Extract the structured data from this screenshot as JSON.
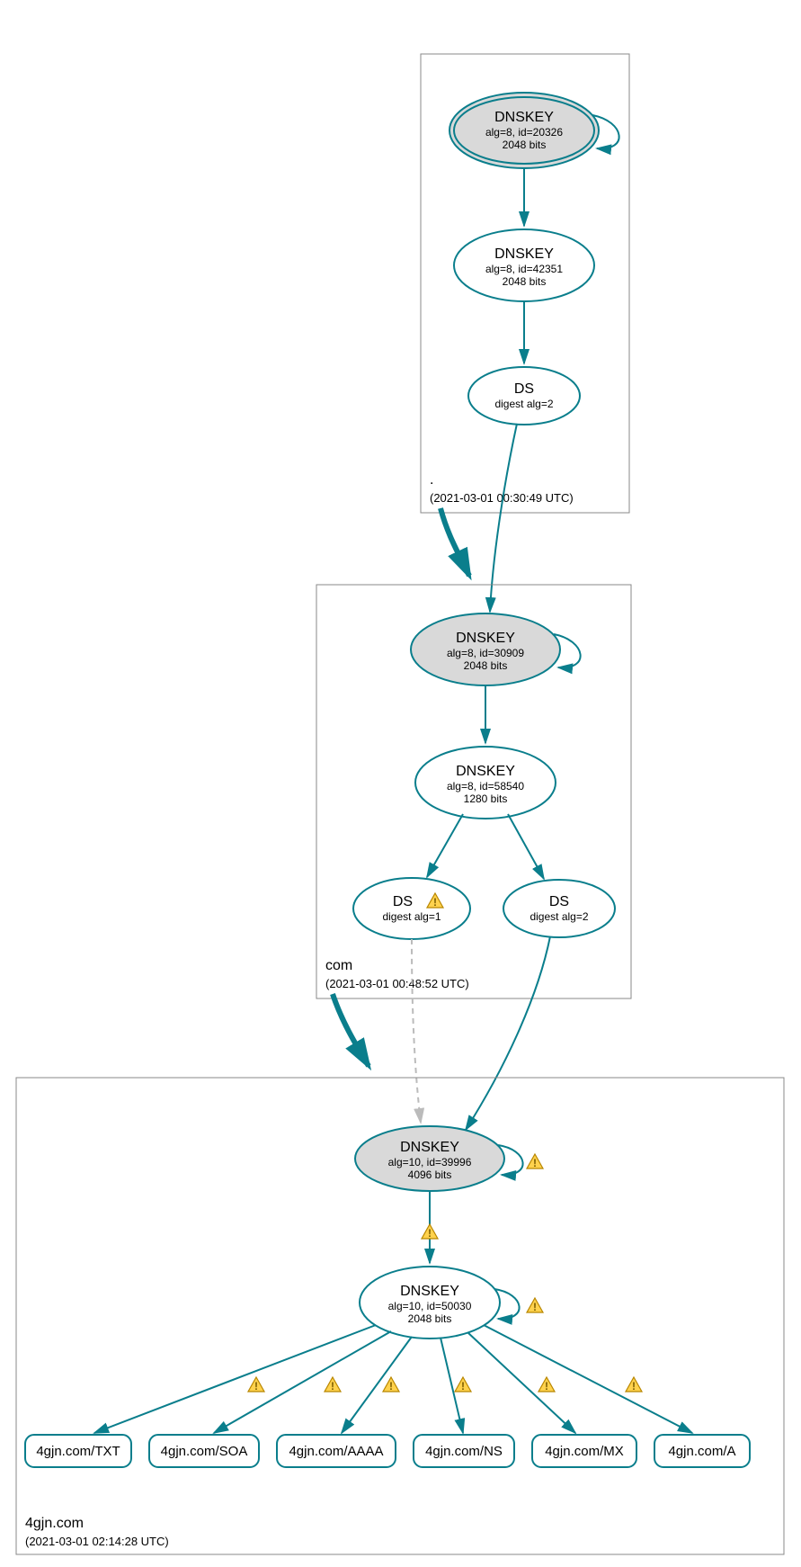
{
  "zones": {
    "root": {
      "label": ".",
      "timestamp": "(2021-03-01 00:30:49 UTC)"
    },
    "com": {
      "label": "com",
      "timestamp": "(2021-03-01 00:48:52 UTC)"
    },
    "leaf": {
      "label": "4gjn.com",
      "timestamp": "(2021-03-01 02:14:28 UTC)"
    }
  },
  "nodes": {
    "root_ksk": {
      "title": "DNSKEY",
      "line1": "alg=8, id=20326",
      "line2": "2048 bits"
    },
    "root_zsk": {
      "title": "DNSKEY",
      "line1": "alg=8, id=42351",
      "line2": "2048 bits"
    },
    "root_ds": {
      "title": "DS",
      "line1": "digest alg=2"
    },
    "com_ksk": {
      "title": "DNSKEY",
      "line1": "alg=8, id=30909",
      "line2": "2048 bits"
    },
    "com_zsk": {
      "title": "DNSKEY",
      "line1": "alg=8, id=58540",
      "line2": "1280 bits"
    },
    "com_ds1": {
      "title": "DS",
      "line1": "digest alg=1"
    },
    "com_ds2": {
      "title": "DS",
      "line1": "digest alg=2"
    },
    "leaf_ksk": {
      "title": "DNSKEY",
      "line1": "alg=10, id=39996",
      "line2": "4096 bits"
    },
    "leaf_zsk": {
      "title": "DNSKEY",
      "line1": "alg=10, id=50030",
      "line2": "2048 bits"
    }
  },
  "rrsets": {
    "txt": "4gjn.com/TXT",
    "soa": "4gjn.com/SOA",
    "aaaa": "4gjn.com/AAAA",
    "ns": "4gjn.com/NS",
    "mx": "4gjn.com/MX",
    "a": "4gjn.com/A"
  }
}
